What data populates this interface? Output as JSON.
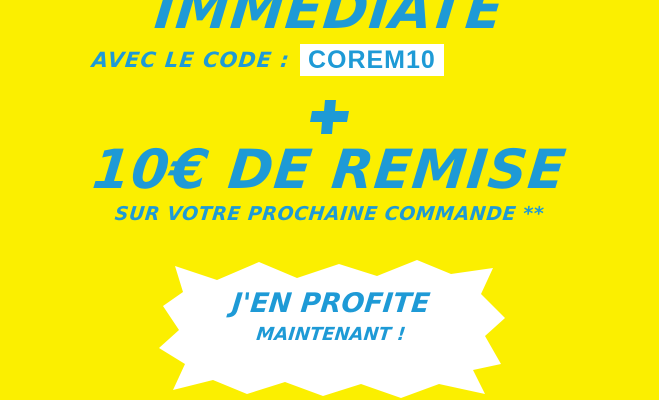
{
  "offer": {
    "headline": "IMMÉDIATE",
    "code_label": "AVEC LE CODE :",
    "code_value": "COREM10",
    "plus_symbol": "plus-icon",
    "remise_title": "10€ DE REMISE",
    "remise_subtitle": "SUR VOTRE PROCHAINE COMMANDE **"
  },
  "cta": {
    "line1": "J'EN PROFITE",
    "line2": "MAINTENANT !"
  },
  "colors": {
    "background": "#fbef00",
    "accent": "#1e9ad6",
    "white": "#ffffff"
  }
}
